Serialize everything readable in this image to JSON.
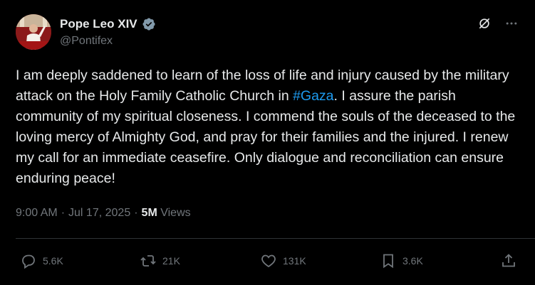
{
  "author": {
    "name": "Pope Leo XIV",
    "handle": "@Pontifex"
  },
  "post": {
    "text_before": "I am deeply saddened to learn of the loss of life and injury caused by the military attack on the Holy Family Catholic Church in ",
    "hashtag": "#Gaza",
    "text_after": ". I assure the parish community of my spiritual closeness. I commend the souls of the deceased to the loving mercy of Almighty God, and pray for their families and the injured. I renew my call for an immediate ceasefire. Only dialogue and reconciliation can ensure enduring peace!",
    "time": "9:00 AM",
    "date": "Jul 17, 2025",
    "separator": "·",
    "views_count": "5M",
    "views_label": "Views"
  },
  "actions": {
    "replies": "5.6K",
    "reposts": "21K",
    "likes": "131K",
    "bookmarks": "3.6K"
  },
  "colors": {
    "background": "#000000",
    "text": "#e7e9ea",
    "secondary": "#71767b",
    "link": "#1d9bf0",
    "verified_badge": "#829aab"
  }
}
